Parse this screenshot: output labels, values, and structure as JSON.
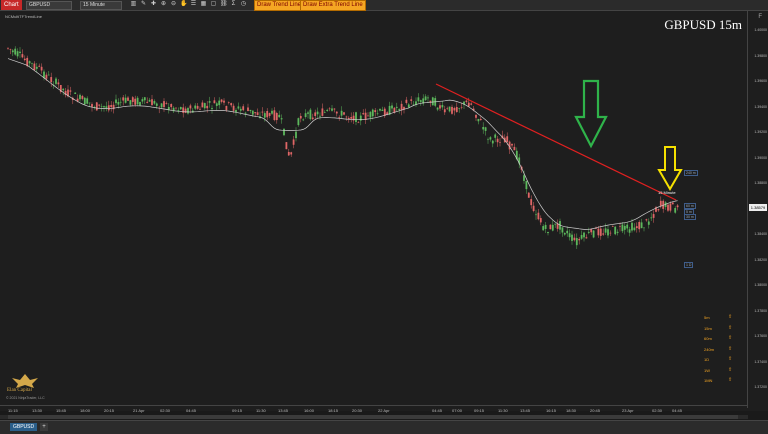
{
  "toolbar": {
    "app_label": "Chart",
    "instrument": "GBPUSD",
    "interval": "15 Minute",
    "draw_trend_line": "Draw Trend Line",
    "draw_extra_trend_line": "Draw Extra Trend Line"
  },
  "chart": {
    "symbol_title": "GBPUSD 15m",
    "indicator_label": "NCMultiTFTrendLine",
    "f_label": "F",
    "copyright": "© 2021 NinjaTrader, LLC",
    "logo_text": "Elan Capital",
    "last_price": "1.38579",
    "trend_line_label": "15 Minute",
    "colors": {
      "up": "#5cb85c",
      "down": "#e06666",
      "trend_line": "#e02020",
      "ma": "#cfcfcf",
      "green_arrow": "#2fb34a",
      "yellow_arrow": "#f5e000"
    },
    "icons": [
      "up-arrow-green",
      "down-arrow-yellow",
      "timeframe-up-arrows"
    ]
  },
  "y_axis": {
    "ticks": [
      "1.40000",
      "1.39800",
      "1.39600",
      "1.39400",
      "1.39200",
      "1.39000",
      "1.38800",
      "1.38600",
      "1.38400",
      "1.38200",
      "1.38000",
      "1.37800",
      "1.37600",
      "1.37400",
      "1.37200"
    ]
  },
  "x_axis": {
    "ticks": [
      "11:15",
      "13:30",
      "15:45",
      "18:00",
      "20:15",
      "21 Apr",
      "02:30",
      "04:45",
      "09:15",
      "11:30",
      "13:45",
      "16:00",
      "18:15",
      "20:30",
      "22 Apr",
      "04:45",
      "07:00",
      "09:15",
      "11:30",
      "13:45",
      "16:15",
      "18:30",
      "20:45",
      "23 Apr",
      "02:30",
      "04:45"
    ]
  },
  "price_markers": [
    {
      "label": "240 m"
    },
    {
      "label": "60 m"
    },
    {
      "label": "5 m"
    },
    {
      "label": "30 m"
    },
    {
      "label": "1 D"
    }
  ],
  "timeframes": [
    {
      "label": "5m"
    },
    {
      "label": "15m"
    },
    {
      "label": "60m"
    },
    {
      "label": "240m"
    },
    {
      "label": "1D"
    },
    {
      "label": "1W"
    },
    {
      "label": "1MN"
    }
  ],
  "status": {
    "tab": "GBPUSD",
    "add": "+"
  }
}
